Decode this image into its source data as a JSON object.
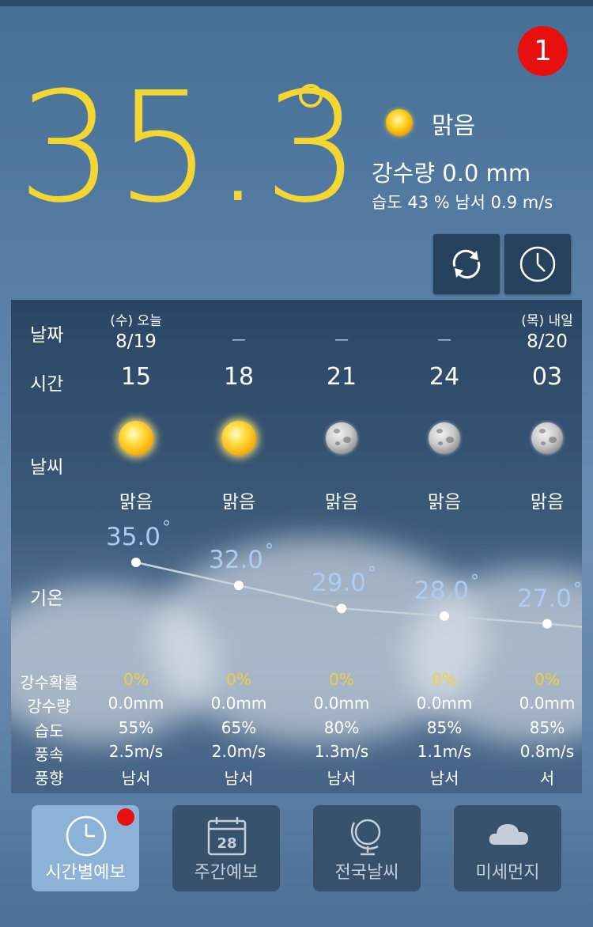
{
  "notification_count": "1",
  "current": {
    "temperature": "35.3",
    "condition": "맑음",
    "precipitation": "강수량 0.0 mm",
    "humidity_wind": "습도 43 %  남서 0.9 m/s"
  },
  "buttons": {
    "refresh_icon": "refresh-icon",
    "clock_icon": "clock-icon"
  },
  "table": {
    "labels": {
      "date": "날짜",
      "time": "시간",
      "weather": "날씨",
      "temp": "기온"
    },
    "columns": [
      {
        "day": "(수) 오늘",
        "date": "8/19",
        "hour": "15",
        "icon": "sun",
        "cond": "맑음",
        "temp": "35.0",
        "pop": "0%",
        "rain": "0.0mm",
        "humidity": "55%",
        "wind_speed": "2.5m/s",
        "wind_dir": "남서"
      },
      {
        "day": "",
        "date": "—",
        "hour": "18",
        "icon": "sun",
        "cond": "맑음",
        "temp": "32.0",
        "pop": "0%",
        "rain": "0.0mm",
        "humidity": "65%",
        "wind_speed": "2.0m/s",
        "wind_dir": "남서"
      },
      {
        "day": "",
        "date": "—",
        "hour": "21",
        "icon": "moon",
        "cond": "맑음",
        "temp": "29.0",
        "pop": "0%",
        "rain": "0.0mm",
        "humidity": "80%",
        "wind_speed": "1.3m/s",
        "wind_dir": "남서"
      },
      {
        "day": "",
        "date": "—",
        "hour": "24",
        "icon": "moon",
        "cond": "맑음",
        "temp": "28.0",
        "pop": "0%",
        "rain": "0.0mm",
        "humidity": "85%",
        "wind_speed": "1.1m/s",
        "wind_dir": "남서"
      },
      {
        "day": "(목) 내일",
        "date": "8/20",
        "hour": "03",
        "icon": "moon",
        "cond": "맑음",
        "temp": "27.0",
        "pop": "0%",
        "rain": "0.0mm",
        "humidity": "85%",
        "wind_speed": "0.8m/s",
        "wind_dir": "서"
      }
    ],
    "stat_labels": {
      "pop": "강수확률",
      "rain": "강수량",
      "humidity": "습도",
      "wind_speed": "풍속",
      "wind_dir": "풍향"
    }
  },
  "nav": [
    {
      "label": "시간별예보",
      "icon": "clock-icon",
      "active": true
    },
    {
      "label": "주간예보",
      "icon": "calendar-icon",
      "calendar_day": "28"
    },
    {
      "label": "전국날씨",
      "icon": "globe-icon"
    },
    {
      "label": "미세먼지",
      "icon": "cloud-icon"
    }
  ],
  "colors": {
    "temp_yellow": "#f3d631",
    "temp_line_blue": "#a9cdf5",
    "badge_red": "#e8100f"
  }
}
